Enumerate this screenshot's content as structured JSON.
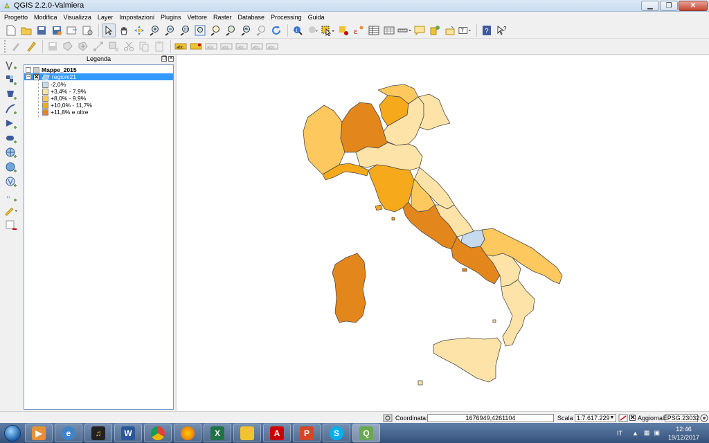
{
  "window": {
    "title": "QGIS 2.2.0-Valmiera"
  },
  "menu": [
    "Progetto",
    "Modifica",
    "Visualizza",
    "Layer",
    "Impostazioni",
    "Plugins",
    "Vettore",
    "Raster",
    "Database",
    "Processing",
    "Guida"
  ],
  "legend_panel": {
    "title": "Legenda",
    "group": "Mappe_2015",
    "layer": "regioni21",
    "classes": [
      {
        "label": "-2,0%",
        "color": "#c6dbef"
      },
      {
        "label": "+3,4% - 7,9%",
        "color": "#fde3a7"
      },
      {
        "label": "+8,0% - 9,9%",
        "color": "#fdc85e"
      },
      {
        "label": "+10,0% - 11,7%",
        "color": "#f6a91b"
      },
      {
        "label": "+11,8% e oltre",
        "color": "#e3861c"
      }
    ]
  },
  "statusbar": {
    "coord_label": "Coordinata:",
    "coord_value": "1676949,4261104",
    "scale_label": "Scala",
    "scale_value": "1:7.617.229",
    "refresh_label": "Aggiorna",
    "crs": "EPSG:23032"
  },
  "taskbar": {
    "lang": "IT",
    "time": "12:46",
    "date": "19/12/2017"
  }
}
